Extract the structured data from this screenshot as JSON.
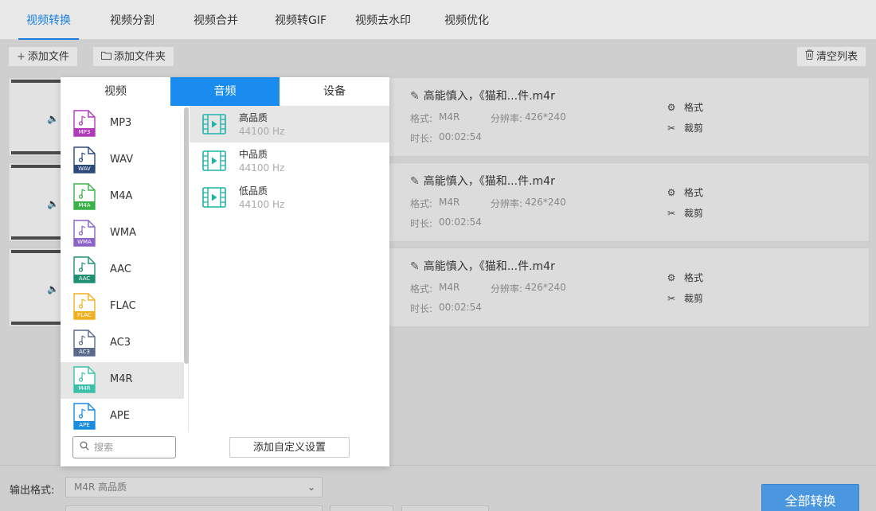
{
  "colors": {
    "accent": "#1a7fe0",
    "popup_tab_active": "#1a8cf0",
    "convert_button": "#4a97e0"
  },
  "topnav": {
    "tabs": [
      {
        "label": "视频转换",
        "active": true
      },
      {
        "label": "视频分割"
      },
      {
        "label": "视频合并"
      },
      {
        "label": "视频转GIF"
      },
      {
        "label": "视频去水印"
      },
      {
        "label": "视频优化"
      }
    ]
  },
  "toolbar": {
    "add_file": "添加文件",
    "add_folder": "添加文件夹",
    "clear_list": "清空列表"
  },
  "files": [
    {
      "name": "高能慎入，《猫和...件.m4r",
      "format_label": "格式:",
      "format": "M4R",
      "resolution_label": "分辨率:",
      "resolution": "426*240",
      "duration_label": "时长:",
      "duration": "00:02:54",
      "action_format": "格式",
      "action_cut": "裁剪"
    },
    {
      "name": "高能慎入，《猫和...件.m4r",
      "format_label": "格式:",
      "format": "M4R",
      "resolution_label": "分辨率:",
      "resolution": "426*240",
      "duration_label": "时长:",
      "duration": "00:02:54",
      "action_format": "格式",
      "action_cut": "裁剪"
    },
    {
      "name": "高能慎入，《猫和...件.m4r",
      "format_label": "格式:",
      "format": "M4R",
      "resolution_label": "分辨率:",
      "resolution": "426*240",
      "duration_label": "时长:",
      "duration": "00:02:54",
      "action_format": "格式",
      "action_cut": "裁剪"
    }
  ],
  "popup": {
    "tabs": [
      {
        "label": "视频"
      },
      {
        "label": "音频",
        "active": true
      },
      {
        "label": "设备"
      }
    ],
    "formats": [
      {
        "name": "MP3",
        "color": "#b03ab8"
      },
      {
        "name": "WAV",
        "color": "#2b4a7a"
      },
      {
        "name": "M4A",
        "color": "#3bb04a"
      },
      {
        "name": "WMA",
        "color": "#8a62c8"
      },
      {
        "name": "AAC",
        "color": "#1f8f74"
      },
      {
        "name": "FLAC",
        "color": "#f0b020"
      },
      {
        "name": "AC3",
        "color": "#5a6a8a"
      },
      {
        "name": "M4R",
        "color": "#3bbfa8",
        "selected": true
      },
      {
        "name": "APE",
        "color": "#1a8ce0"
      }
    ],
    "search_placeholder": "搜索",
    "qualities": [
      {
        "name": "高品质",
        "hz": "44100 Hz",
        "selected": true
      },
      {
        "name": "中品质",
        "hz": "44100 Hz"
      },
      {
        "name": "低品质",
        "hz": "44100 Hz"
      }
    ],
    "add_custom": "添加自定义设置"
  },
  "bottombar": {
    "output_format_label": "输出格式:",
    "output_format_value": "M4R  高品质",
    "convert_all": "全部转换"
  }
}
